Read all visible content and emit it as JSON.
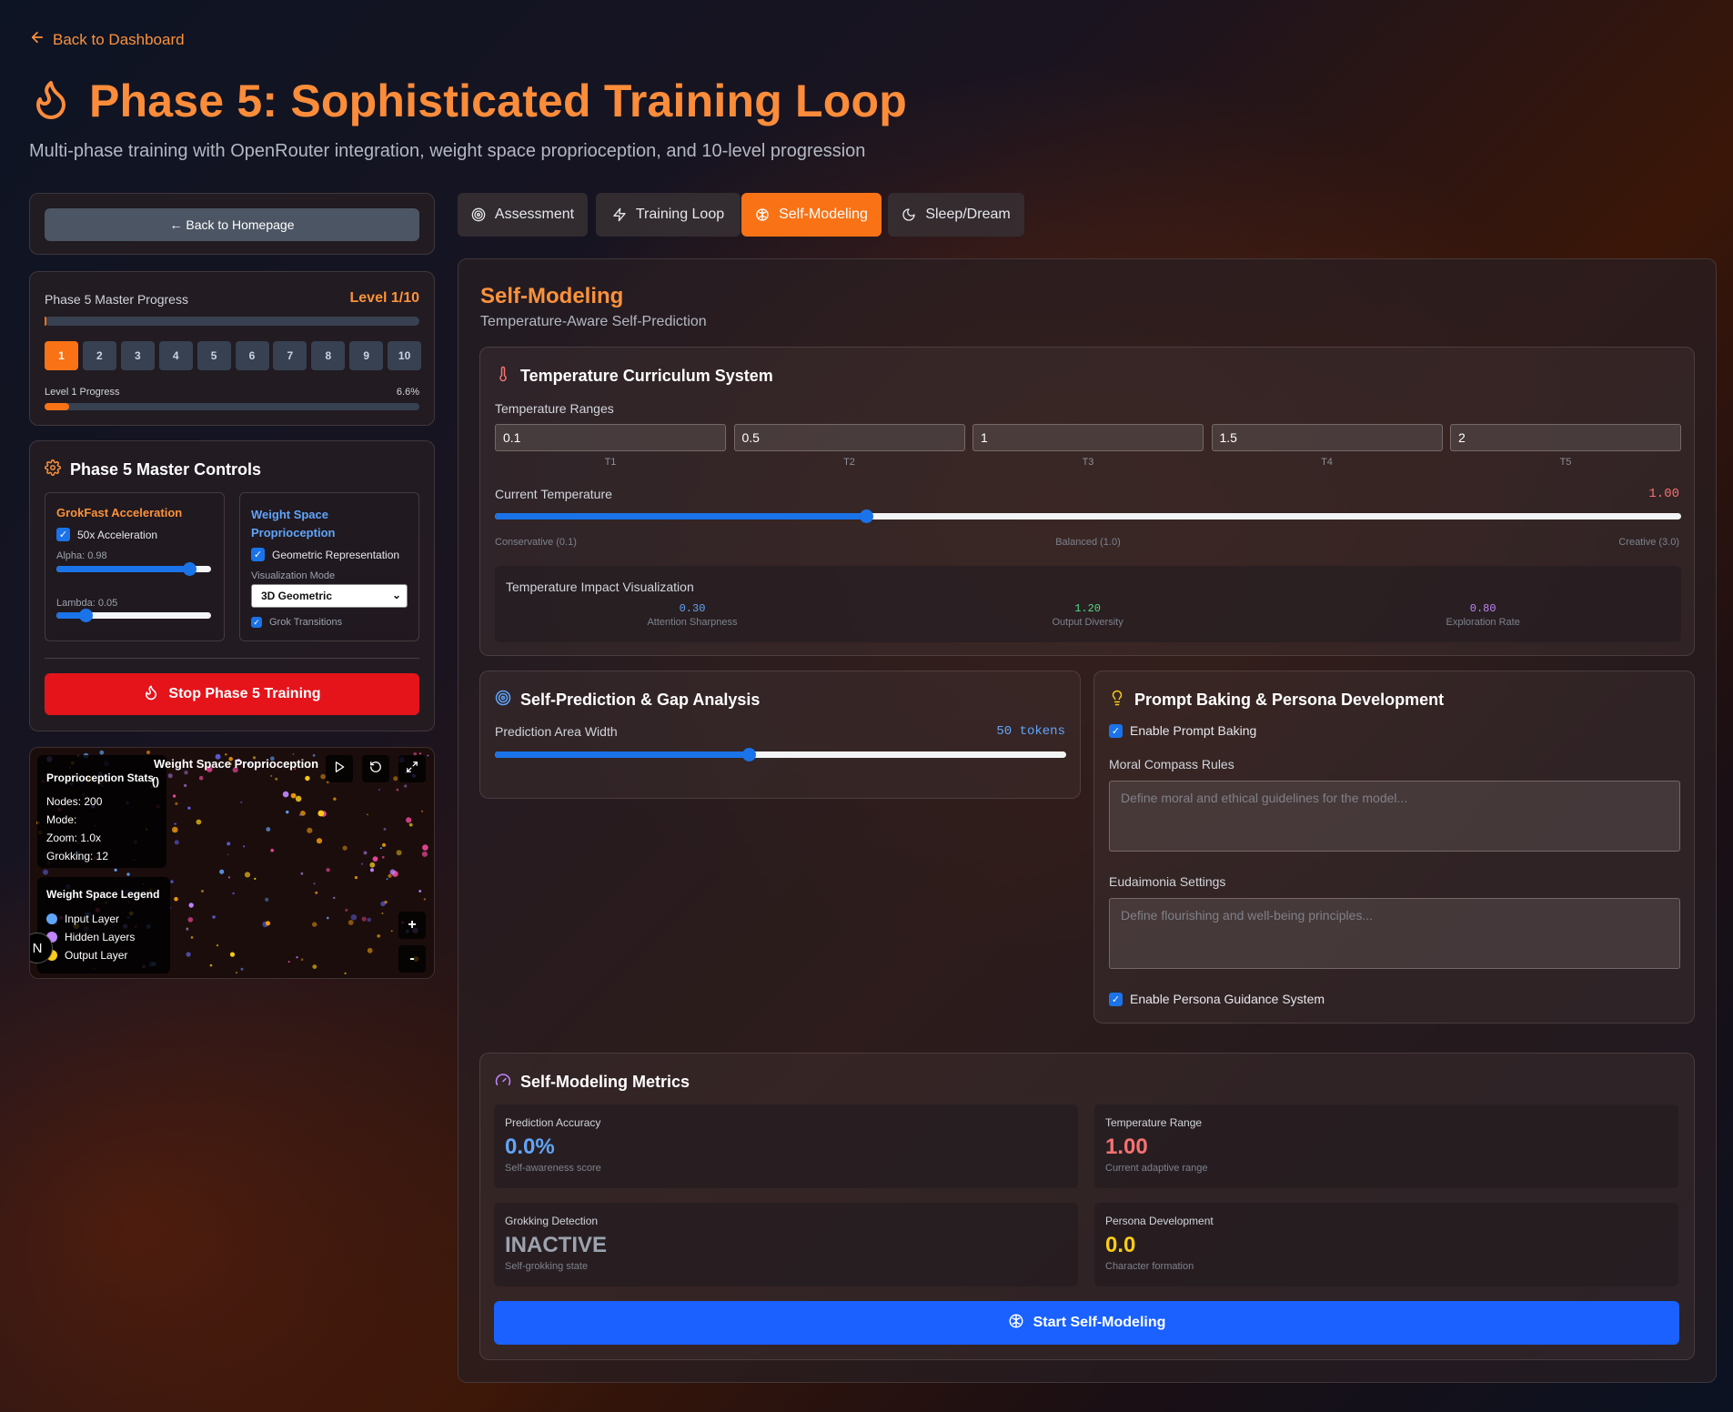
{
  "header": {
    "back_label": "Back to Dashboard",
    "title": "Phase 5: Sophisticated Training Loop",
    "subtitle": "Multi-phase training with OpenRouter integration, weight space proprioception, and 10-level progression"
  },
  "sidebar": {
    "home_button": "← Back to Homepage",
    "progress": {
      "label": "Phase 5 Master Progress",
      "level_text": "Level 1/10",
      "master_fraction": 0.004,
      "levels": [
        "1",
        "2",
        "3",
        "4",
        "5",
        "6",
        "7",
        "8",
        "9",
        "10"
      ],
      "active_level": 0,
      "level_label": "Level 1 Progress",
      "level_percent_text": "6.6%",
      "level_fraction": 0.066
    },
    "controls": {
      "title": "Phase 5 Master Controls",
      "grokfast": {
        "title": "GrokFast Acceleration",
        "accel_label": "50x Acceleration",
        "alpha_label": "Alpha: 0.98",
        "alpha_fraction": 0.86,
        "lambda_label": "Lambda: 0.05",
        "lambda_fraction": 0.19
      },
      "weight_space": {
        "title": "Weight Space Proprioception",
        "geo_label": "Geometric Representation",
        "mode_label": "Visualization Mode",
        "mode_value": "3D Geometric",
        "grok_label": "Grok Transitions"
      },
      "stop_button": "Stop Phase 5 Training"
    },
    "viz": {
      "title": "Weight Space Proprioception",
      "stats_title": "Proprioception Stats",
      "paren": "()",
      "nodes": "Nodes: 200",
      "mode": "Mode:",
      "zoom": "Zoom: 1.0x",
      "grokking": "Grokking: 12",
      "legend_title": "Weight Space Legend",
      "legend": [
        {
          "label": "Input Layer",
          "color": "#60a5fa"
        },
        {
          "label": "Hidden Layers",
          "color": "#c084fc"
        },
        {
          "label": "Output Layer",
          "color": "#facc15"
        }
      ],
      "zoom_in": "+",
      "zoom_out": "-",
      "badge": "N"
    }
  },
  "tabs": [
    {
      "label": "Assessment",
      "icon": "target-icon"
    },
    {
      "label": "Training Loop",
      "icon": "lightning-icon"
    },
    {
      "label": "Self-Modeling",
      "icon": "brain-icon"
    },
    {
      "label": "Sleep/Dream",
      "icon": "moon-icon"
    }
  ],
  "main": {
    "title": "Self-Modeling",
    "subtitle": "Temperature-Aware Self-Prediction",
    "curriculum": {
      "title": "Temperature Curriculum System",
      "ranges_label": "Temperature Ranges",
      "ranges": [
        {
          "value": "0.1",
          "tag": "T1"
        },
        {
          "value": "0.5",
          "tag": "T2"
        },
        {
          "value": "1",
          "tag": "T3"
        },
        {
          "value": "1.5",
          "tag": "T4"
        },
        {
          "value": "2",
          "tag": "T5"
        }
      ],
      "current_label": "Current Temperature",
      "current_value": "1.00",
      "current_fraction": 0.313,
      "scale_left": "Conservative (0.1)",
      "scale_mid": "Balanced (1.0)",
      "scale_right": "Creative (3.0)",
      "impact_title": "Temperature Impact Visualization",
      "impacts": [
        {
          "value": "0.30",
          "label": "Attention Sharpness",
          "color": "#60a5fa"
        },
        {
          "value": "1.20",
          "label": "Output Diversity",
          "color": "#4ade80"
        },
        {
          "value": "0.80",
          "label": "Exploration Rate",
          "color": "#c084fc"
        }
      ]
    },
    "prediction": {
      "title": "Self-Prediction & Gap Analysis",
      "width_label": "Prediction Area Width",
      "width_value": "50 tokens",
      "width_fraction": 0.445
    },
    "prompt": {
      "title": "Prompt Baking & Persona Development",
      "enable_label": "Enable Prompt Baking",
      "moral_label": "Moral Compass Rules",
      "moral_placeholder": "Define moral and ethical guidelines for the model...",
      "eud_label": "Eudaimonia Settings",
      "eud_placeholder": "Define flourishing and well-being principles...",
      "persona_label": "Enable Persona Guidance System"
    },
    "metrics": {
      "title": "Self-Modeling Metrics",
      "items": [
        {
          "label": "Prediction Accuracy",
          "value": "0.0%",
          "sub": "Self-awareness score",
          "color": "#60a5fa"
        },
        {
          "label": "Temperature Range",
          "value": "1.00",
          "sub": "Current adaptive range",
          "color": "#f87171"
        },
        {
          "label": "Grokking Detection",
          "value": "INACTIVE",
          "sub": "Self-grokking state",
          "color": "#9ca3af"
        },
        {
          "label": "Persona Development",
          "value": "0.0",
          "sub": "Character formation",
          "color": "#facc15"
        }
      ],
      "start_button": "Start Self-Modeling"
    }
  }
}
